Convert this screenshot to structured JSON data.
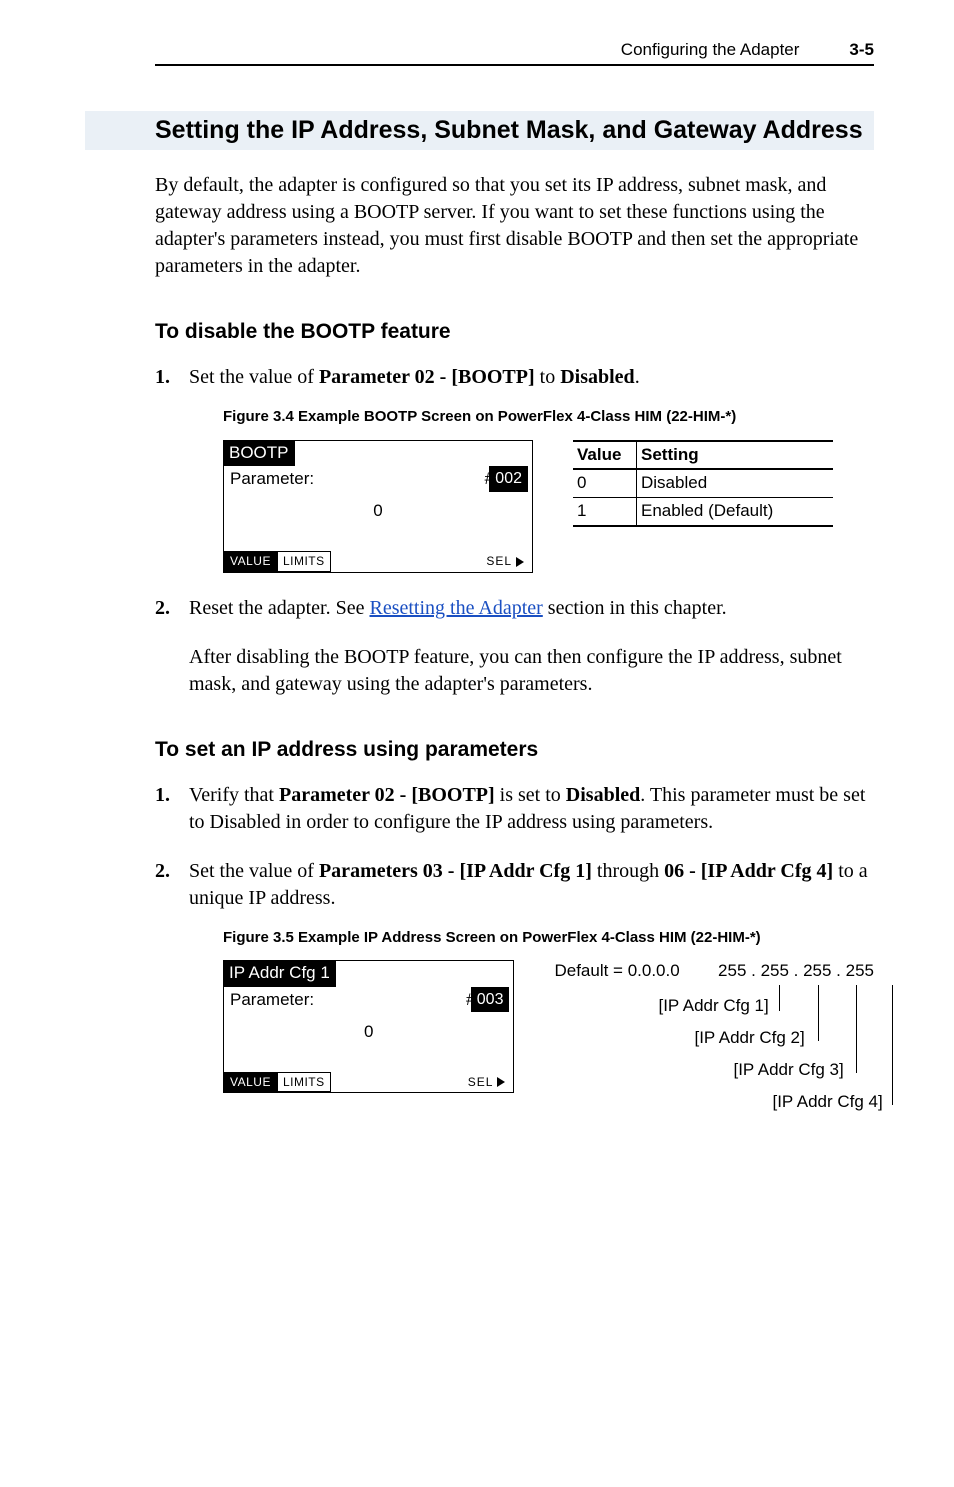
{
  "header": {
    "title": "Configuring the Adapter",
    "page": "3-5"
  },
  "section": {
    "title": "Setting the IP Address, Subnet Mask, and Gateway Address",
    "intro": "By default, the adapter is configured so that you set its IP address, subnet mask, and gateway address using a BOOTP server. If you want to set these functions using the adapter's parameters instead, you must first disable BOOTP and then set the appropriate parameters in the adapter."
  },
  "bootp": {
    "heading": "To disable the BOOTP feature",
    "step1_a": "Set the value of ",
    "step1_b": "Parameter 02 - [BOOTP]",
    "step1_c": " to ",
    "step1_d": "Disabled",
    "step1_e": ".",
    "fig_label": "Figure 3.4   Example BOOTP Screen on PowerFlex 4-Class HIM (22-HIM-*)",
    "him": {
      "title": "BOOTP",
      "param_label": "Parameter:",
      "hash": "#",
      "num": "002",
      "center_value": "0",
      "tag_value": "VALUE",
      "tag_limits": "LIMITS",
      "sel": "SEL"
    },
    "table_header_value": "Value",
    "table_header_setting": "Setting",
    "table": [
      {
        "value": "0",
        "setting": "Disabled"
      },
      {
        "value": "1",
        "setting": "Enabled (Default)"
      }
    ],
    "step2_a": "Reset the adapter. See ",
    "step2_link": "Resetting the Adapter",
    "step2_b": " section in this chapter.",
    "after": "After disabling the BOOTP feature, you can then configure the IP address, subnet mask, and gateway using the adapter's parameters."
  },
  "ipset": {
    "heading": "To set an IP address using parameters",
    "step1_a": "Verify that ",
    "step1_b": "Parameter 02 - [BOOTP]",
    "step1_c": " is set to ",
    "step1_d": "Disabled",
    "step1_e": ". This parameter must be set to Disabled in order to configure the IP address using parameters.",
    "step2_a": "Set the value of ",
    "step2_b": "Parameters 03 - [IP Addr Cfg 1]",
    "step2_c": " through ",
    "step2_d": "06 - [IP Addr Cfg 4]",
    "step2_e": " to a unique IP address.",
    "fig_label": "Figure 3.5   Example IP Address Screen on PowerFlex 4-Class HIM (22-HIM-*)",
    "him": {
      "title": "IP Addr Cfg 1",
      "param_label": "Parameter:",
      "hash": "#",
      "num": "003",
      "center_value": "0",
      "tag_value": "VALUE",
      "tag_limits": "LIMITS",
      "sel": "SEL"
    },
    "diagram": {
      "default_label": "Default = 0.0.0.0",
      "range_label": "255 . 255 . 255 . 255",
      "cfg1": "[IP Addr Cfg 1]",
      "cfg2": "[IP Addr Cfg 2]",
      "cfg3": "[IP Addr Cfg 3]",
      "cfg4": "[IP Addr Cfg 4]"
    }
  }
}
